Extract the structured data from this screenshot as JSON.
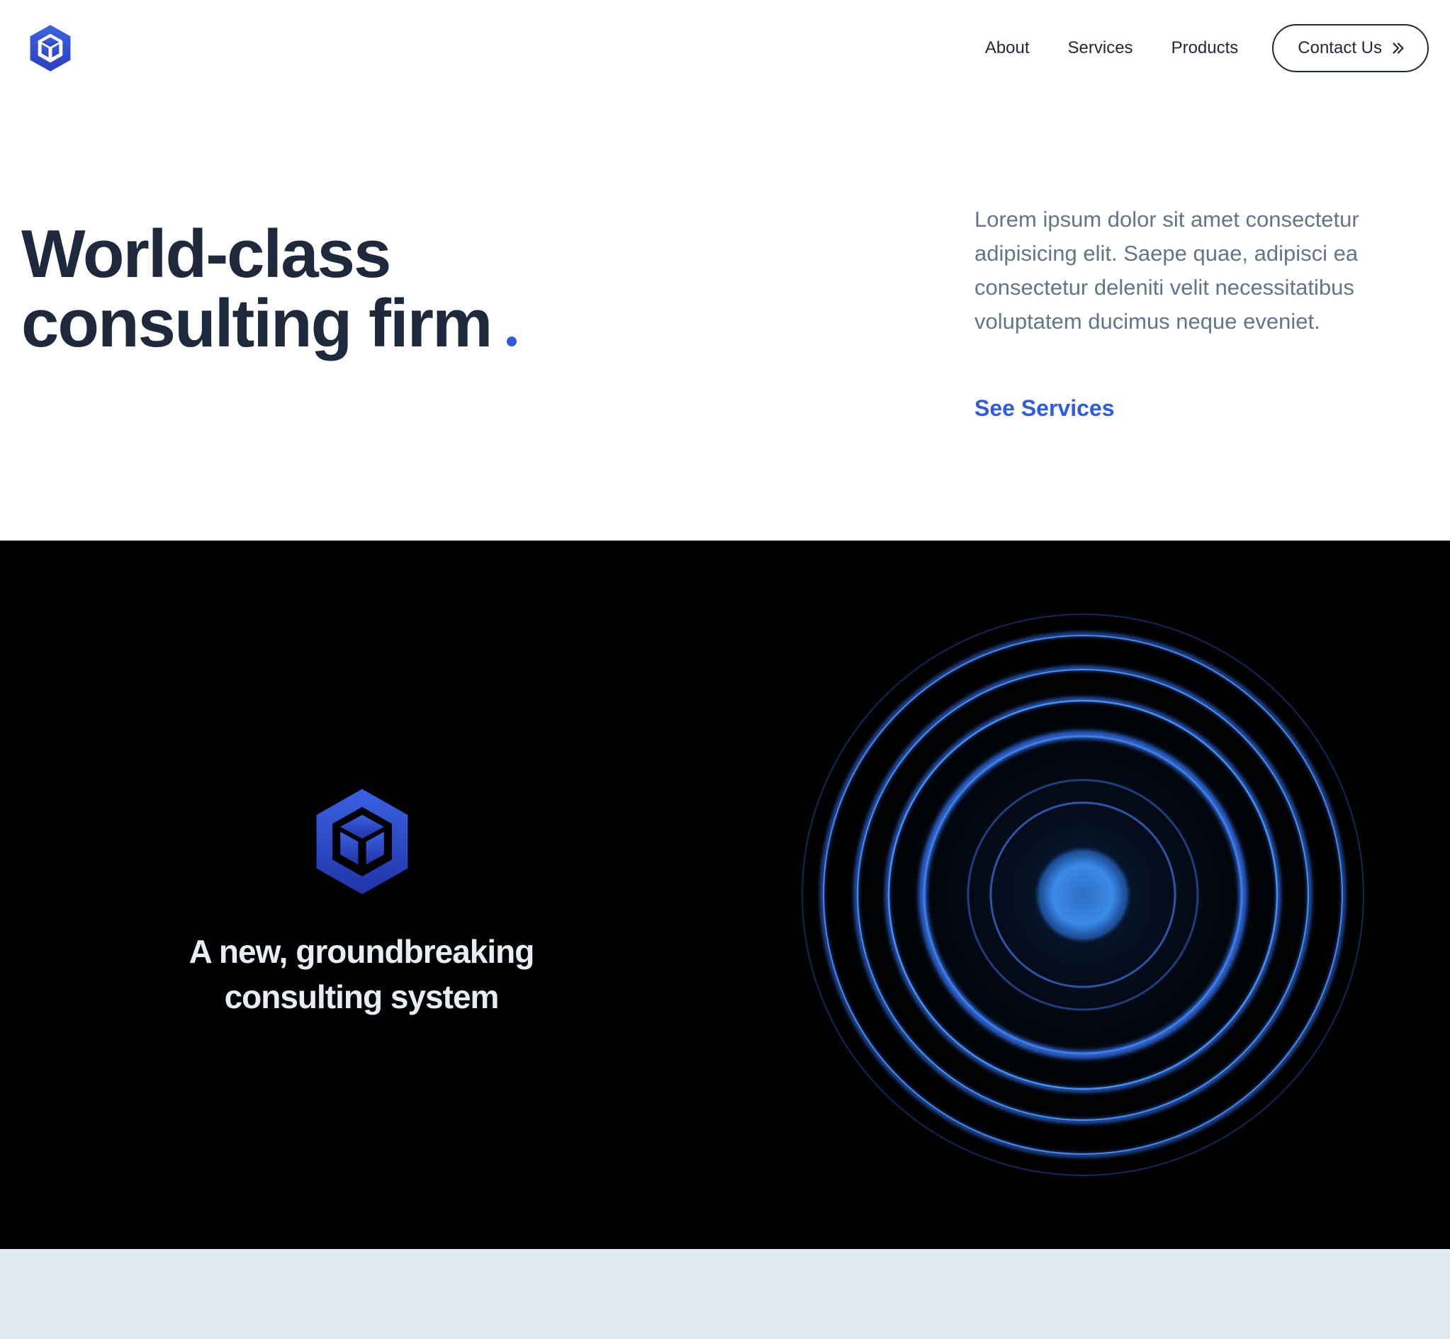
{
  "header": {
    "logo_icon": "hexagon-cube-logo-icon",
    "nav": {
      "about": "About",
      "services": "Services",
      "products": "Products"
    },
    "contact_label": "Contact Us",
    "contact_icon": "double-chevron-right-icon"
  },
  "hero": {
    "title_line1": "World-class",
    "title_line2": "consulting firm",
    "description": "Lorem ipsum dolor sit amet consectetur adipisicing elit. Saepe quae, adipisci ea consectetur deleniti velit necessitatibus voluptatem ducimus neque eveniet.",
    "cta": "See Services"
  },
  "feature": {
    "logo_icon": "hexagon-cube-logo-icon",
    "tagline": "A new, groundbreaking consulting system",
    "image": "concentric-blue-rings-image"
  },
  "colors": {
    "accent": "#2f5bdc",
    "heading": "#1e293b",
    "body_text": "#64748b",
    "dark_bg": "#000000",
    "footer_bg": "#e2e8f0"
  }
}
